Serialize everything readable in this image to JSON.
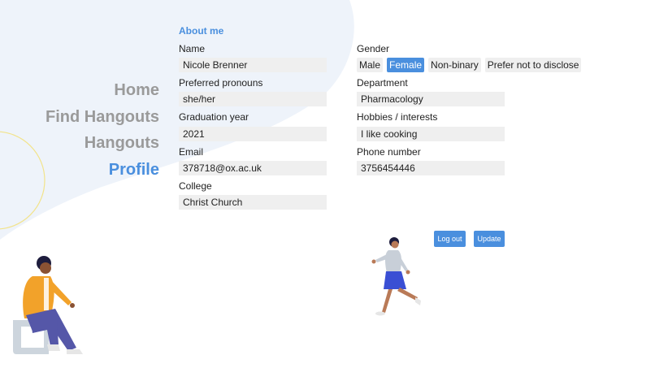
{
  "nav": {
    "items": [
      {
        "label": "Home",
        "active": false
      },
      {
        "label": "Find Hangouts",
        "active": false
      },
      {
        "label": "Hangouts",
        "active": false
      },
      {
        "label": "Profile",
        "active": true
      }
    ]
  },
  "profile": {
    "section_title": "About me",
    "name": {
      "label": "Name",
      "value": "Nicole Brenner"
    },
    "pronouns": {
      "label": "Preferred pronouns",
      "value": "she/her"
    },
    "graduation": {
      "label": "Graduation year",
      "value": "2021"
    },
    "email": {
      "label": "Email",
      "value": "378718@ox.ac.uk"
    },
    "college": {
      "label": "College",
      "value": "Christ Church"
    },
    "gender": {
      "label": "Gender",
      "options": [
        "Male",
        "Female",
        "Non-binary",
        "Prefer not to disclose"
      ],
      "selected": "Female"
    },
    "department": {
      "label": "Department",
      "value": "Pharmacology"
    },
    "hobbies": {
      "label": "Hobbies / interests",
      "value": "I like cooking"
    },
    "phone": {
      "label": "Phone number",
      "value": "3756454446"
    }
  },
  "actions": {
    "logout_label": "Log out",
    "update_label": "Update"
  },
  "colors": {
    "accent": "#4a8fde",
    "nav_inactive": "#9a9a9a",
    "input_bg": "#efefef",
    "blob": "#eef3fa",
    "ring": "#f2e38a"
  },
  "icons": {
    "illustration_left": "person-sitting-illustration",
    "illustration_right": "person-walking-illustration"
  }
}
